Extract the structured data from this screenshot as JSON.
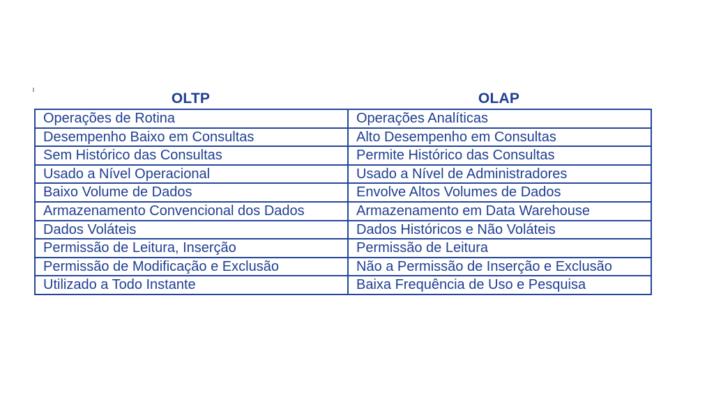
{
  "table": {
    "headers": {
      "oltp": "OLTP",
      "olap": "OLAP"
    },
    "rows": [
      {
        "oltp": "Operações de Rotina",
        "olap": "Operações Analíticas"
      },
      {
        "oltp": "Desempenho Baixo em Consultas",
        "olap": "Alto Desempenho em Consultas"
      },
      {
        "oltp": "Sem Histórico das Consultas",
        "olap": "Permite Histórico das Consultas"
      },
      {
        "oltp": "Usado a Nível Operacional",
        "olap": "Usado a Nível de Administradores"
      },
      {
        "oltp": "Baixo Volume de Dados",
        "olap": "Envolve Altos Volumes de Dados"
      },
      {
        "oltp": "Armazenamento Convencional dos Dados",
        "olap": "Armazenamento em Data Warehouse"
      },
      {
        "oltp": "Dados Voláteis",
        "olap": "Dados Históricos e Não Voláteis"
      },
      {
        "oltp": "Permissão de Leitura, Inserção",
        "olap": "Permissão de Leitura"
      },
      {
        "oltp": "Permissão de Modificação e Exclusão",
        "olap": "Não a Permissão de Inserção e Exclusão"
      },
      {
        "oltp": "Utilizado a Todo Instante",
        "olap": "Baixa Frequência de Uso e Pesquisa"
      }
    ]
  },
  "colors": {
    "text": "#1f3f91",
    "border": "#24469a",
    "background": "#ffffff"
  }
}
